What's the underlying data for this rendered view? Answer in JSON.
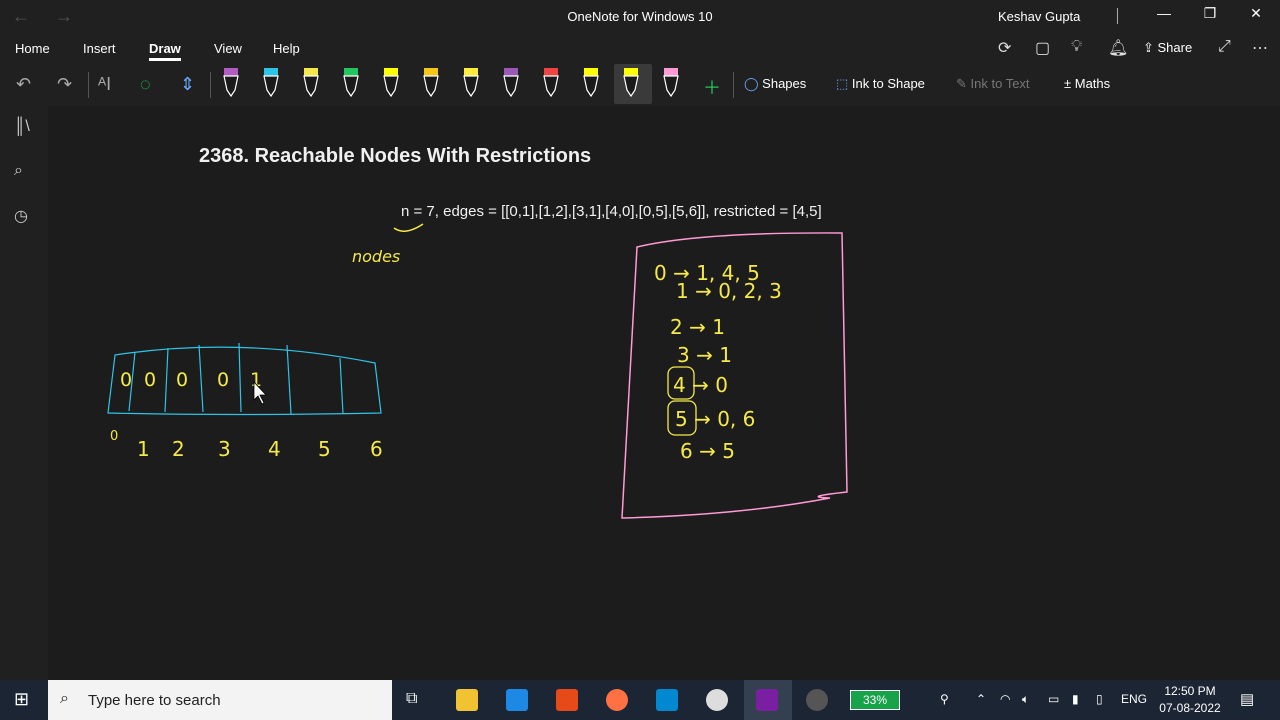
{
  "window": {
    "title": "OneNote for Windows 10",
    "user": "Keshav Gupta",
    "back": "←",
    "forward": "→",
    "minimize": "—",
    "restore": "❐",
    "close": "✕"
  },
  "menu": {
    "items": [
      "Home",
      "Insert",
      "Draw",
      "View",
      "Help"
    ],
    "active": "Draw",
    "share_label": "Share"
  },
  "toolbar": {
    "pens": [
      {
        "color": "#b05cc0"
      },
      {
        "color": "#2ec4e8"
      },
      {
        "color": "#f5e94a"
      },
      {
        "color": "#22c55e"
      },
      {
        "color": "#ffff00"
      },
      {
        "color": "#f5c518"
      },
      {
        "color": "#ffeb3b"
      },
      {
        "color": "#9b59b6"
      },
      {
        "color": "#ef4444"
      },
      {
        "color": "#ffff00"
      },
      {
        "color": "#ffff00"
      },
      {
        "color": "#ff9ad5"
      }
    ],
    "shapes_label": "Shapes",
    "ink_to_shape_label": "Ink to Shape",
    "ink_to_text_label": "Ink to Text",
    "maths_label": "Maths"
  },
  "page": {
    "title": "2368. Reachable Nodes With Restrictions",
    "problem": "n = 7, edges = [[0,1],[1,2],[3,1],[4,0],[0,5],[5,6]], restricted = [4,5]",
    "ink": {
      "nodes_label": "nodes",
      "array_values": [
        "0",
        "0",
        "0",
        "0",
        "1"
      ],
      "array_indices": [
        "0",
        "1",
        "2",
        "3",
        "4",
        "5",
        "6"
      ],
      "adjacency": [
        {
          "node": "0",
          "neighbors": "1, 4, 5"
        },
        {
          "node": "1",
          "neighbors": "0, 2, 3"
        },
        {
          "node": "2",
          "neighbors": "1"
        },
        {
          "node": "3",
          "neighbors": "1"
        },
        {
          "node": "4",
          "neighbors": "0"
        },
        {
          "node": "5",
          "neighbors": "0, 6"
        },
        {
          "node": "6",
          "neighbors": "5"
        }
      ],
      "colors": {
        "pink": "#ff9ad5",
        "yellow": "#f5e94a",
        "cyan": "#2ec4e8"
      }
    }
  },
  "taskbar": {
    "search_placeholder": "Type here to search",
    "battery": "33%",
    "language": "ENG",
    "time": "12:50 PM",
    "date": "07-08-2022"
  }
}
